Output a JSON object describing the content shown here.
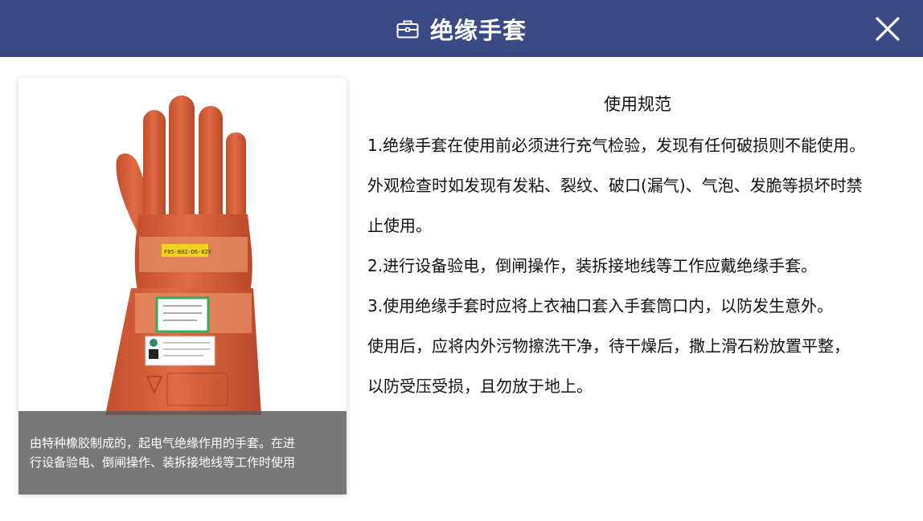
{
  "header": {
    "title": "绝缘手套",
    "icon": "toolbox-icon",
    "close_icon": "close-icon",
    "background": "#3a4a84"
  },
  "image_card": {
    "caption_line1": "由特种橡胶制成的，起电气绝缘作用的手套。在进",
    "caption_line2": "行设备验电、倒闸操作、装拆接地线等工作时使用",
    "glove_color": "#d9603a",
    "tag_text": "F05-B02-D6-02Y"
  },
  "rules": {
    "title": "使用规范",
    "lines": [
      "1.绝缘手套在使用前必须进行充气检验，发现有任何破损则不能使用。",
      "外观检查时如发现有发粘、裂纹、破口(漏气)、气泡、发脆等损坏时禁",
      "止使用。",
      "2.进行设备验电，倒闸操作，装拆接地线等工作应戴绝缘手套。",
      "3.使用绝缘手套时应将上衣袖口套入手套筒口内，以防发生意外。",
      "使用后，应将内外污物擦洗干净，待干燥后，撒上滑石粉放置平整，",
      "以防受压受损，且勿放于地上。"
    ]
  }
}
